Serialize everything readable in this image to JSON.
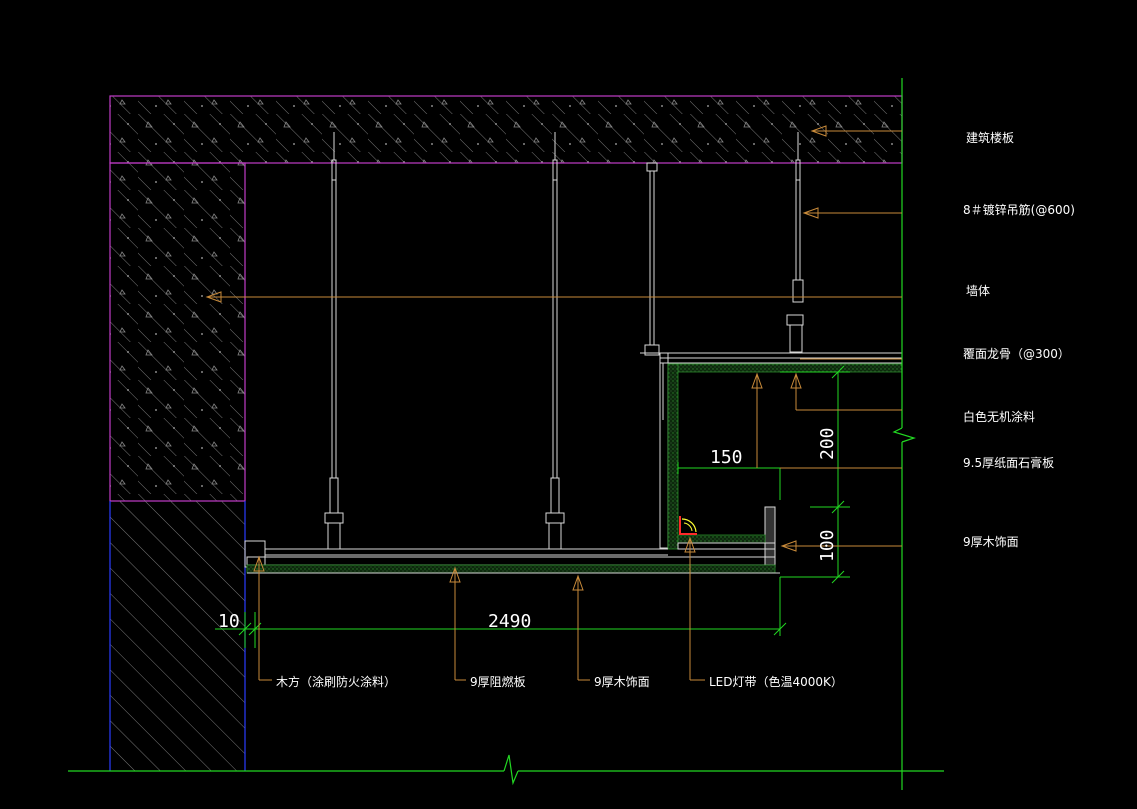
{
  "labels": {
    "floor_slab": "建筑楼板",
    "hanger_rod": "8＃镀锌吊筋(@600)",
    "wall": "墙体",
    "keel": "覆面龙骨（@300）",
    "white_paint": "白色无机涂料",
    "gypsum_board": "9.5厚纸面石膏板",
    "wood_finish_right": "9厚木饰面",
    "wood_block": "木方（涂刷防火涂料）",
    "fireproof_board": "9厚阻燃板",
    "wood_finish_bottom": "9厚木饰面",
    "led_strip": "LED灯带（色温4000K）"
  },
  "dimensions": {
    "d150": "150",
    "d200": "200",
    "d100": "100",
    "d10": "10",
    "d2490": "2490"
  },
  "colors": {
    "background": "#000000",
    "slab_outline": "#c03cc8",
    "wall_outline": "#2a3cff",
    "dimension": "#22d822",
    "leader": "#c88a3a",
    "hatch": "#8a8a8a",
    "structure": "#d8d8d8",
    "led": "#ff2a2a"
  }
}
